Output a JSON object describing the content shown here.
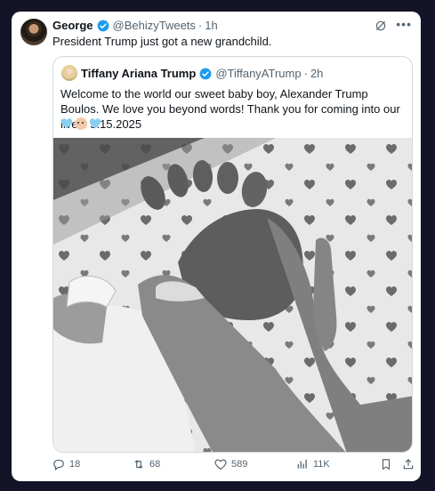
{
  "tweet": {
    "author_name": "George",
    "author_handle": "@BehizyTweets",
    "time": "1h",
    "text": "President Trump just got a new grandchild."
  },
  "quoted": {
    "author_name": "Tiffany Ariana Trump",
    "author_handle": "@TiffanyATrump",
    "time": "2h",
    "text": "Welcome to the world our sweet baby boy, Alexander Trump Boulos. We love you beyond words! Thank you for coming into our lives! 5.15.2025",
    "emojis": [
      "light-blue-heart",
      "baby-face",
      "light-blue-heart"
    ],
    "photo": "black-and-white photo of baby foot held in hand"
  },
  "actions": {
    "replies": "18",
    "reposts": "68",
    "likes": "589",
    "views": "11K"
  },
  "colors": {
    "verified": "#1d9bf0",
    "text": "#0f1419",
    "muted": "#536471",
    "page_bg": "#141428",
    "heart": "#89cff0"
  }
}
